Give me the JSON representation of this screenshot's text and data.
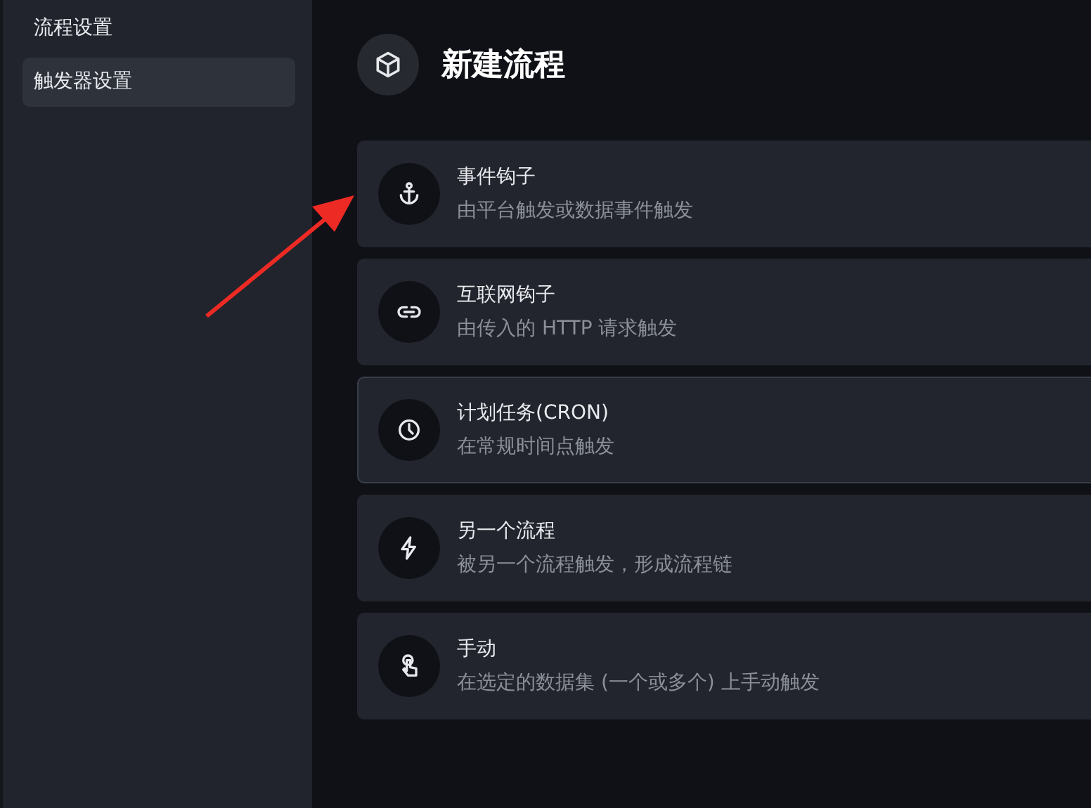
{
  "sidebar": {
    "items": [
      {
        "label": "流程设置",
        "selected": false
      },
      {
        "label": "触发器设置",
        "selected": true
      }
    ]
  },
  "header": {
    "title": "新建流程"
  },
  "triggers": [
    {
      "kind": "anchor",
      "title": "事件钩子",
      "description": "由平台触发或数据事件触发",
      "highlighted": false
    },
    {
      "kind": "link",
      "title": "互联网钩子",
      "description": "由传入的 HTTP 请求触发",
      "highlighted": false
    },
    {
      "kind": "clock",
      "title": "计划任务(CRON)",
      "description": "在常规时间点触发",
      "highlighted": true
    },
    {
      "kind": "bolt",
      "title": "另一个流程",
      "description": "被另一个流程触发，形成流程链",
      "highlighted": false
    },
    {
      "kind": "hand",
      "title": "手动",
      "description": "在选定的数据集 (一个或多个) 上手动触发",
      "highlighted": false
    }
  ]
}
